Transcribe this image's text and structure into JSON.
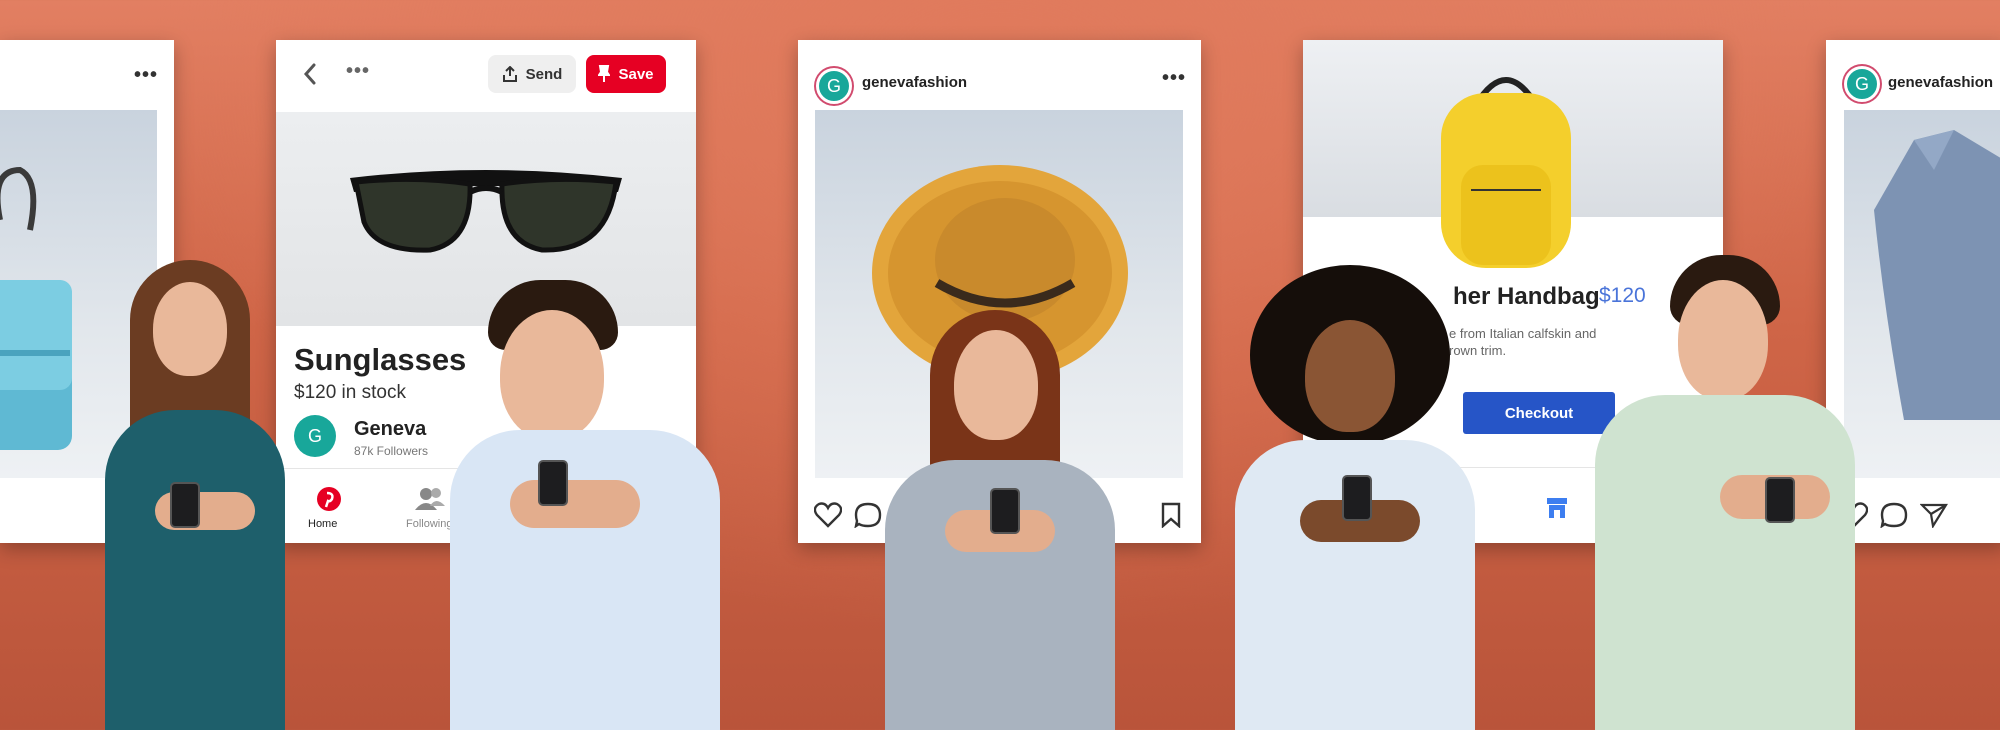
{
  "colors": {
    "background": "#cd6446",
    "pinterest_red": "#e60023",
    "instagram_ring": "#d14b6e",
    "avatar_teal": "#18a79a",
    "checkout_blue": "#2655c7",
    "price_blue": "#4a74d9"
  },
  "card_left": {
    "menu_icon": "more-horizontal-icon",
    "product_icon": "handbag-icon"
  },
  "pinterest_card": {
    "back_icon": "chevron-left-icon",
    "menu_icon": "more-horizontal-icon",
    "send_label": "Send",
    "save_label": "Save",
    "product_name": "Sunglasses",
    "price_stock": "$120 in stock",
    "seller_initial": "G",
    "seller_name": "Geneva",
    "seller_followers": "87k Followers",
    "nav_home": "Home",
    "nav_following": "Following"
  },
  "instagram_card": {
    "avatar_initial": "G",
    "username": "genevafashion",
    "menu_icon": "more-horizontal-icon"
  },
  "shop_card": {
    "product_title": "her Handbag",
    "price": "$120",
    "description_line1": "e from Italian calfskin and",
    "description_line2": "rown trim.",
    "checkout_label": "Checkout"
  },
  "instagram_card_right": {
    "avatar_initial": "G",
    "username": "genevafashion"
  }
}
